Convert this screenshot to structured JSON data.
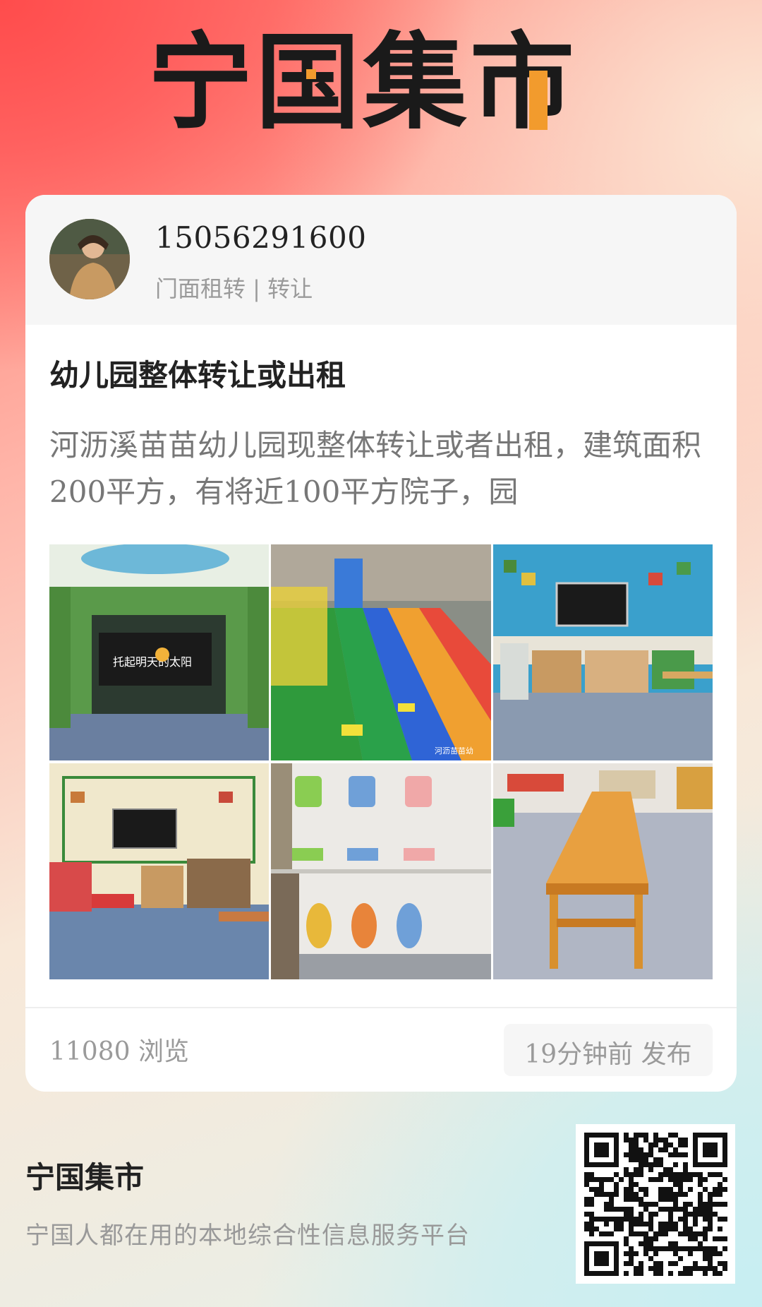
{
  "logo": {
    "text": "宁国集市"
  },
  "post": {
    "phone": "15056291600",
    "category": "门面租转 | 转让",
    "title": "幼儿园整体转让或出租",
    "body": "河沥溪苗苗幼儿园现整体转让或者出租，建筑面积200平方，有将近100平方院子，园",
    "images": [
      "hallway-with-sign",
      "colorful-playground",
      "blue-classroom",
      "classroom-with-tv",
      "toilets-urinals",
      "wooden-table"
    ],
    "sign_text": "托起明天的太阳",
    "watermark": "河沥苗苗幼",
    "views": "11080 浏览",
    "time": "19分钟前 发布"
  },
  "footer": {
    "brand": "宁国集市",
    "slogan": "宁国人都在用的本地综合性信息服务平台"
  },
  "colors": {
    "accent": "#f29b2d",
    "text_dark": "#222222",
    "text_muted": "#9a9a9a"
  }
}
